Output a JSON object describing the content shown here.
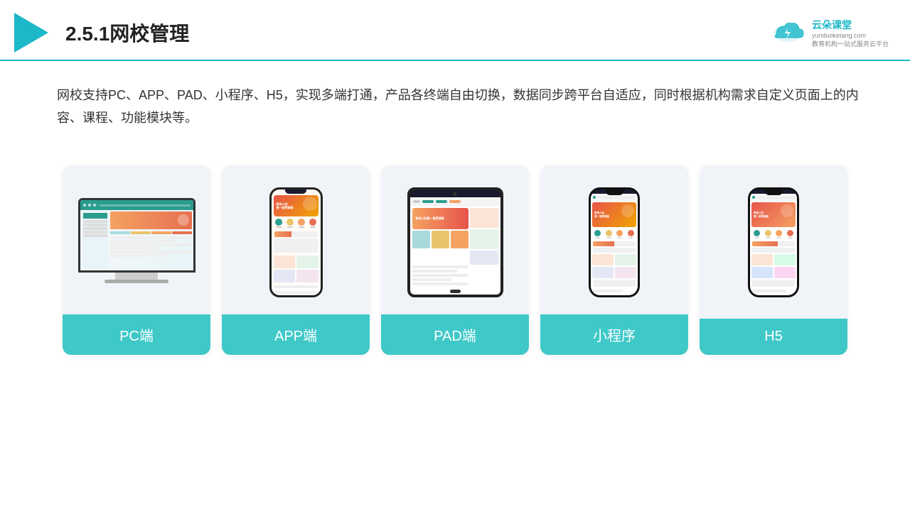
{
  "header": {
    "title": "2.5.1网校管理",
    "logo": {
      "chinese_name": "云朵课堂",
      "english_name": "yunduoketang.com",
      "slogan": "教育机构一站\n式服务云平台"
    }
  },
  "description": {
    "text": "网校支持PC、APP、PAD、小程序、H5，实现多端打通，产品各终端自由切换，数据同步跨平台自适应，同时根据机构需求自定义页面上的内容、课程、功能模块等。"
  },
  "cards": [
    {
      "label": "PC端"
    },
    {
      "label": "APP端"
    },
    {
      "label": "PAD端"
    },
    {
      "label": "小程序"
    },
    {
      "label": "H5"
    }
  ],
  "colors": {
    "accent": "#1db8c8",
    "card_label_bg": "#3fc8c8",
    "card_bg": "#f0f4f8"
  }
}
